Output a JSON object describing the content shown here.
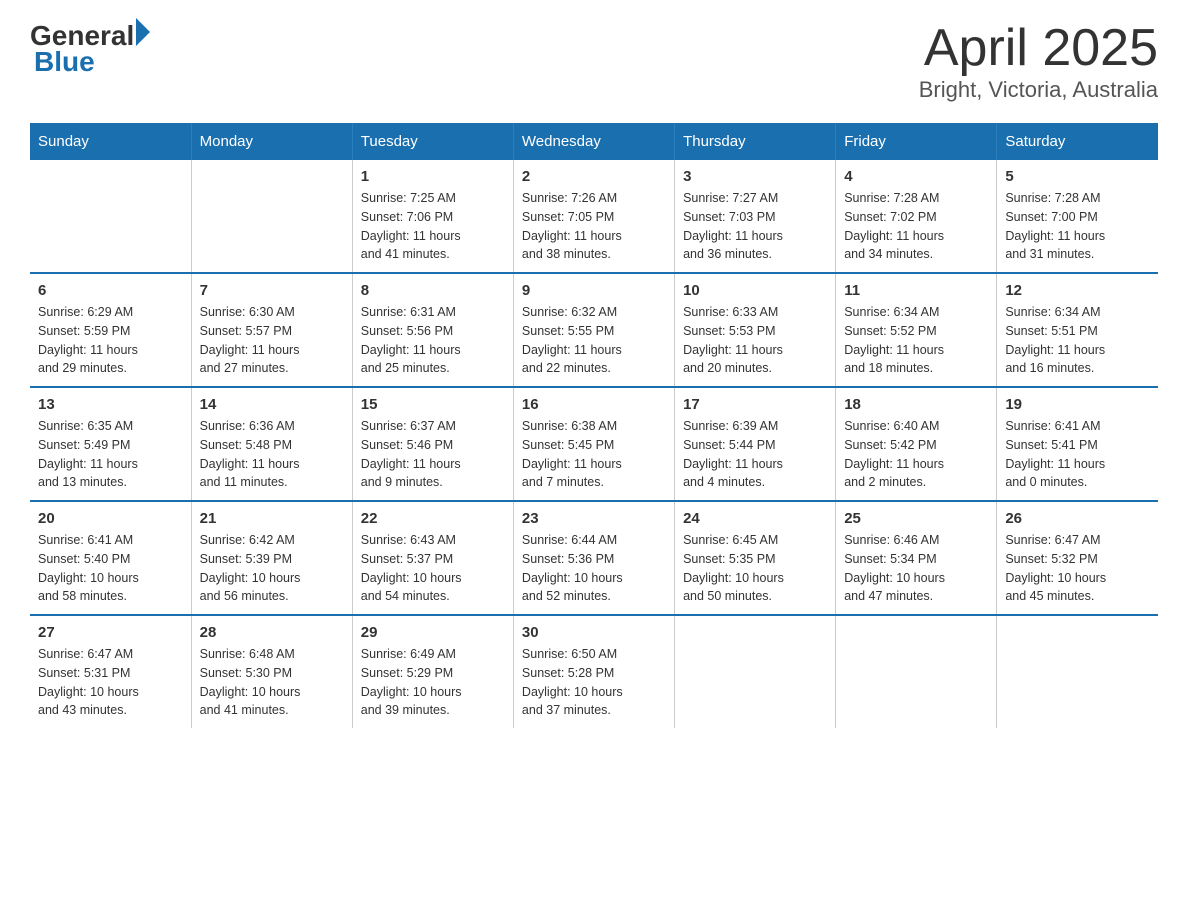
{
  "header": {
    "logo_general": "General",
    "logo_blue": "Blue",
    "title": "April 2025",
    "subtitle": "Bright, Victoria, Australia"
  },
  "weekdays": [
    "Sunday",
    "Monday",
    "Tuesday",
    "Wednesday",
    "Thursday",
    "Friday",
    "Saturday"
  ],
  "weeks": [
    [
      {
        "day": "",
        "info": ""
      },
      {
        "day": "",
        "info": ""
      },
      {
        "day": "1",
        "info": "Sunrise: 7:25 AM\nSunset: 7:06 PM\nDaylight: 11 hours\nand 41 minutes."
      },
      {
        "day": "2",
        "info": "Sunrise: 7:26 AM\nSunset: 7:05 PM\nDaylight: 11 hours\nand 38 minutes."
      },
      {
        "day": "3",
        "info": "Sunrise: 7:27 AM\nSunset: 7:03 PM\nDaylight: 11 hours\nand 36 minutes."
      },
      {
        "day": "4",
        "info": "Sunrise: 7:28 AM\nSunset: 7:02 PM\nDaylight: 11 hours\nand 34 minutes."
      },
      {
        "day": "5",
        "info": "Sunrise: 7:28 AM\nSunset: 7:00 PM\nDaylight: 11 hours\nand 31 minutes."
      }
    ],
    [
      {
        "day": "6",
        "info": "Sunrise: 6:29 AM\nSunset: 5:59 PM\nDaylight: 11 hours\nand 29 minutes."
      },
      {
        "day": "7",
        "info": "Sunrise: 6:30 AM\nSunset: 5:57 PM\nDaylight: 11 hours\nand 27 minutes."
      },
      {
        "day": "8",
        "info": "Sunrise: 6:31 AM\nSunset: 5:56 PM\nDaylight: 11 hours\nand 25 minutes."
      },
      {
        "day": "9",
        "info": "Sunrise: 6:32 AM\nSunset: 5:55 PM\nDaylight: 11 hours\nand 22 minutes."
      },
      {
        "day": "10",
        "info": "Sunrise: 6:33 AM\nSunset: 5:53 PM\nDaylight: 11 hours\nand 20 minutes."
      },
      {
        "day": "11",
        "info": "Sunrise: 6:34 AM\nSunset: 5:52 PM\nDaylight: 11 hours\nand 18 minutes."
      },
      {
        "day": "12",
        "info": "Sunrise: 6:34 AM\nSunset: 5:51 PM\nDaylight: 11 hours\nand 16 minutes."
      }
    ],
    [
      {
        "day": "13",
        "info": "Sunrise: 6:35 AM\nSunset: 5:49 PM\nDaylight: 11 hours\nand 13 minutes."
      },
      {
        "day": "14",
        "info": "Sunrise: 6:36 AM\nSunset: 5:48 PM\nDaylight: 11 hours\nand 11 minutes."
      },
      {
        "day": "15",
        "info": "Sunrise: 6:37 AM\nSunset: 5:46 PM\nDaylight: 11 hours\nand 9 minutes."
      },
      {
        "day": "16",
        "info": "Sunrise: 6:38 AM\nSunset: 5:45 PM\nDaylight: 11 hours\nand 7 minutes."
      },
      {
        "day": "17",
        "info": "Sunrise: 6:39 AM\nSunset: 5:44 PM\nDaylight: 11 hours\nand 4 minutes."
      },
      {
        "day": "18",
        "info": "Sunrise: 6:40 AM\nSunset: 5:42 PM\nDaylight: 11 hours\nand 2 minutes."
      },
      {
        "day": "19",
        "info": "Sunrise: 6:41 AM\nSunset: 5:41 PM\nDaylight: 11 hours\nand 0 minutes."
      }
    ],
    [
      {
        "day": "20",
        "info": "Sunrise: 6:41 AM\nSunset: 5:40 PM\nDaylight: 10 hours\nand 58 minutes."
      },
      {
        "day": "21",
        "info": "Sunrise: 6:42 AM\nSunset: 5:39 PM\nDaylight: 10 hours\nand 56 minutes."
      },
      {
        "day": "22",
        "info": "Sunrise: 6:43 AM\nSunset: 5:37 PM\nDaylight: 10 hours\nand 54 minutes."
      },
      {
        "day": "23",
        "info": "Sunrise: 6:44 AM\nSunset: 5:36 PM\nDaylight: 10 hours\nand 52 minutes."
      },
      {
        "day": "24",
        "info": "Sunrise: 6:45 AM\nSunset: 5:35 PM\nDaylight: 10 hours\nand 50 minutes."
      },
      {
        "day": "25",
        "info": "Sunrise: 6:46 AM\nSunset: 5:34 PM\nDaylight: 10 hours\nand 47 minutes."
      },
      {
        "day": "26",
        "info": "Sunrise: 6:47 AM\nSunset: 5:32 PM\nDaylight: 10 hours\nand 45 minutes."
      }
    ],
    [
      {
        "day": "27",
        "info": "Sunrise: 6:47 AM\nSunset: 5:31 PM\nDaylight: 10 hours\nand 43 minutes."
      },
      {
        "day": "28",
        "info": "Sunrise: 6:48 AM\nSunset: 5:30 PM\nDaylight: 10 hours\nand 41 minutes."
      },
      {
        "day": "29",
        "info": "Sunrise: 6:49 AM\nSunset: 5:29 PM\nDaylight: 10 hours\nand 39 minutes."
      },
      {
        "day": "30",
        "info": "Sunrise: 6:50 AM\nSunset: 5:28 PM\nDaylight: 10 hours\nand 37 minutes."
      },
      {
        "day": "",
        "info": ""
      },
      {
        "day": "",
        "info": ""
      },
      {
        "day": "",
        "info": ""
      }
    ]
  ]
}
